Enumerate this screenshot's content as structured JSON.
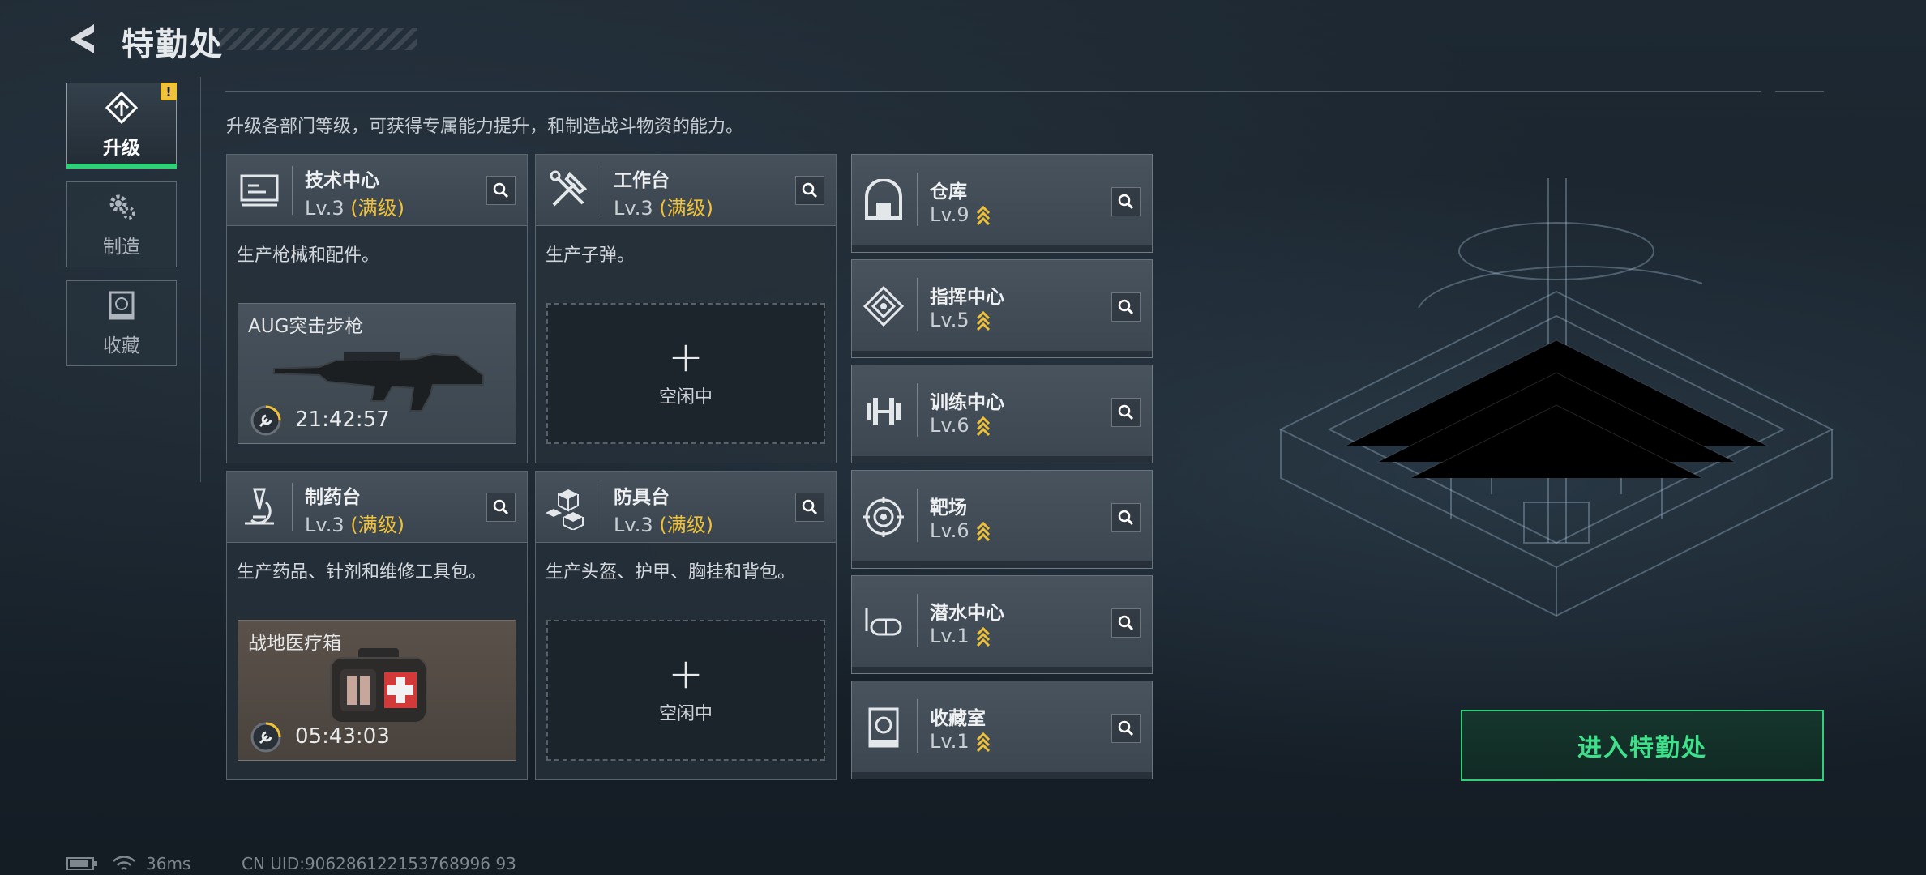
{
  "header": {
    "title": "特勤处"
  },
  "nav": [
    {
      "id": "upgrade",
      "label": "升级",
      "icon": "upgrade-icon",
      "active": true,
      "alert": "!"
    },
    {
      "id": "craft",
      "label": "制造",
      "icon": "gears-icon",
      "active": false
    },
    {
      "id": "collect",
      "label": "收藏",
      "icon": "collection-icon",
      "active": false
    }
  ],
  "description": "升级各部门等级，可获得专属能力提升，和制造战斗物资的能力。",
  "workshops": [
    {
      "name": "技术中心",
      "level": "Lv.3",
      "max_tag": "(满级)",
      "desc": "生产枪械和配件。",
      "icon": "computer-icon",
      "slot": {
        "state": "crafting",
        "item": "AUG突击步枪",
        "timer": "21:42:57"
      }
    },
    {
      "name": "工作台",
      "level": "Lv.3",
      "max_tag": "(满级)",
      "desc": "生产子弹。",
      "icon": "tools-icon",
      "slot": {
        "state": "idle",
        "label": "空闲中"
      }
    },
    {
      "name": "制药台",
      "level": "Lv.3",
      "max_tag": "(满级)",
      "desc": "生产药品、针剂和维修工具包。",
      "icon": "microscope-icon",
      "slot": {
        "state": "crafting",
        "item": "战地医疗箱",
        "timer": "05:43:03"
      }
    },
    {
      "name": "防具台",
      "level": "Lv.3",
      "max_tag": "(满级)",
      "desc": "生产头盔、护甲、胸挂和背包。",
      "icon": "cubes-icon",
      "slot": {
        "state": "idle",
        "label": "空闲中"
      }
    }
  ],
  "facilities": [
    {
      "name": "仓库",
      "level": "Lv.9",
      "icon": "warehouse-icon"
    },
    {
      "name": "指挥中心",
      "level": "Lv.5",
      "icon": "command-icon"
    },
    {
      "name": "训练中心",
      "level": "Lv.6",
      "icon": "dumbbell-icon"
    },
    {
      "name": "靶场",
      "level": "Lv.6",
      "icon": "target-icon"
    },
    {
      "name": "潜水中心",
      "level": "Lv.1",
      "icon": "diving-mask-icon"
    },
    {
      "name": "收藏室",
      "level": "Lv.1",
      "icon": "collection-room-icon"
    }
  ],
  "enter_button": "进入特勤处",
  "status": {
    "ping": "36ms",
    "uid": "CN UID:906286122153768996 93"
  },
  "colors": {
    "accent_green": "#2fd178",
    "level_gold": "#f0c23a"
  }
}
